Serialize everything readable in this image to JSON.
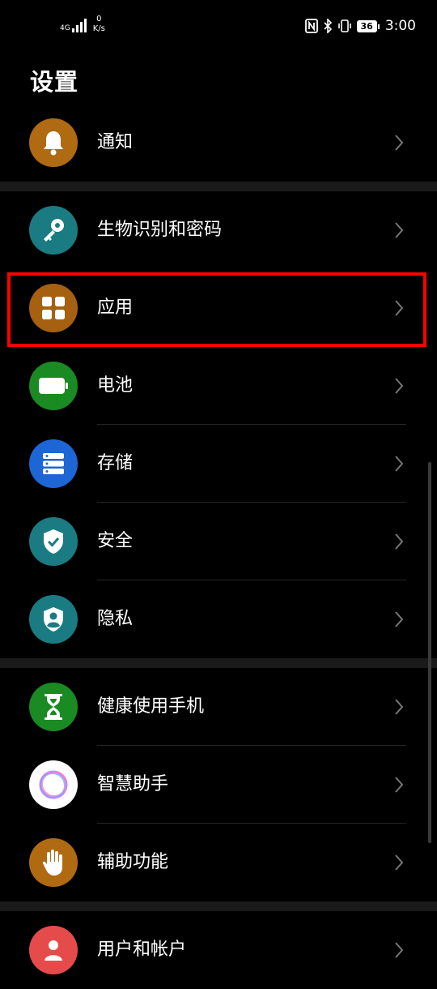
{
  "status_bar": {
    "network": "4G",
    "speed_value": "0",
    "speed_unit": "K/s",
    "battery": "36",
    "time": "3:00"
  },
  "page": {
    "title": "设置"
  },
  "menu": {
    "notifications": "通知",
    "biometrics": "生物识别和密码",
    "apps": "应用",
    "battery": "电池",
    "storage": "存储",
    "security": "安全",
    "privacy": "隐私",
    "digital_balance": "健康使用手机",
    "assistant": "智慧助手",
    "accessibility": "辅助功能",
    "users_accounts": "用户和帐户"
  },
  "colors": {
    "notifications": "#b06a12",
    "biometrics": "#1a7c82",
    "apps": "#a5610f",
    "battery": "#1a8a23",
    "storage": "#1d66d6",
    "security": "#1a7c82",
    "privacy": "#1a7c82",
    "digital_balance": "#1a8a23",
    "assistant": "#ffffff",
    "accessibility": "#b06a12",
    "users_accounts": "#e64b4b",
    "highlight": "#ff0000"
  }
}
